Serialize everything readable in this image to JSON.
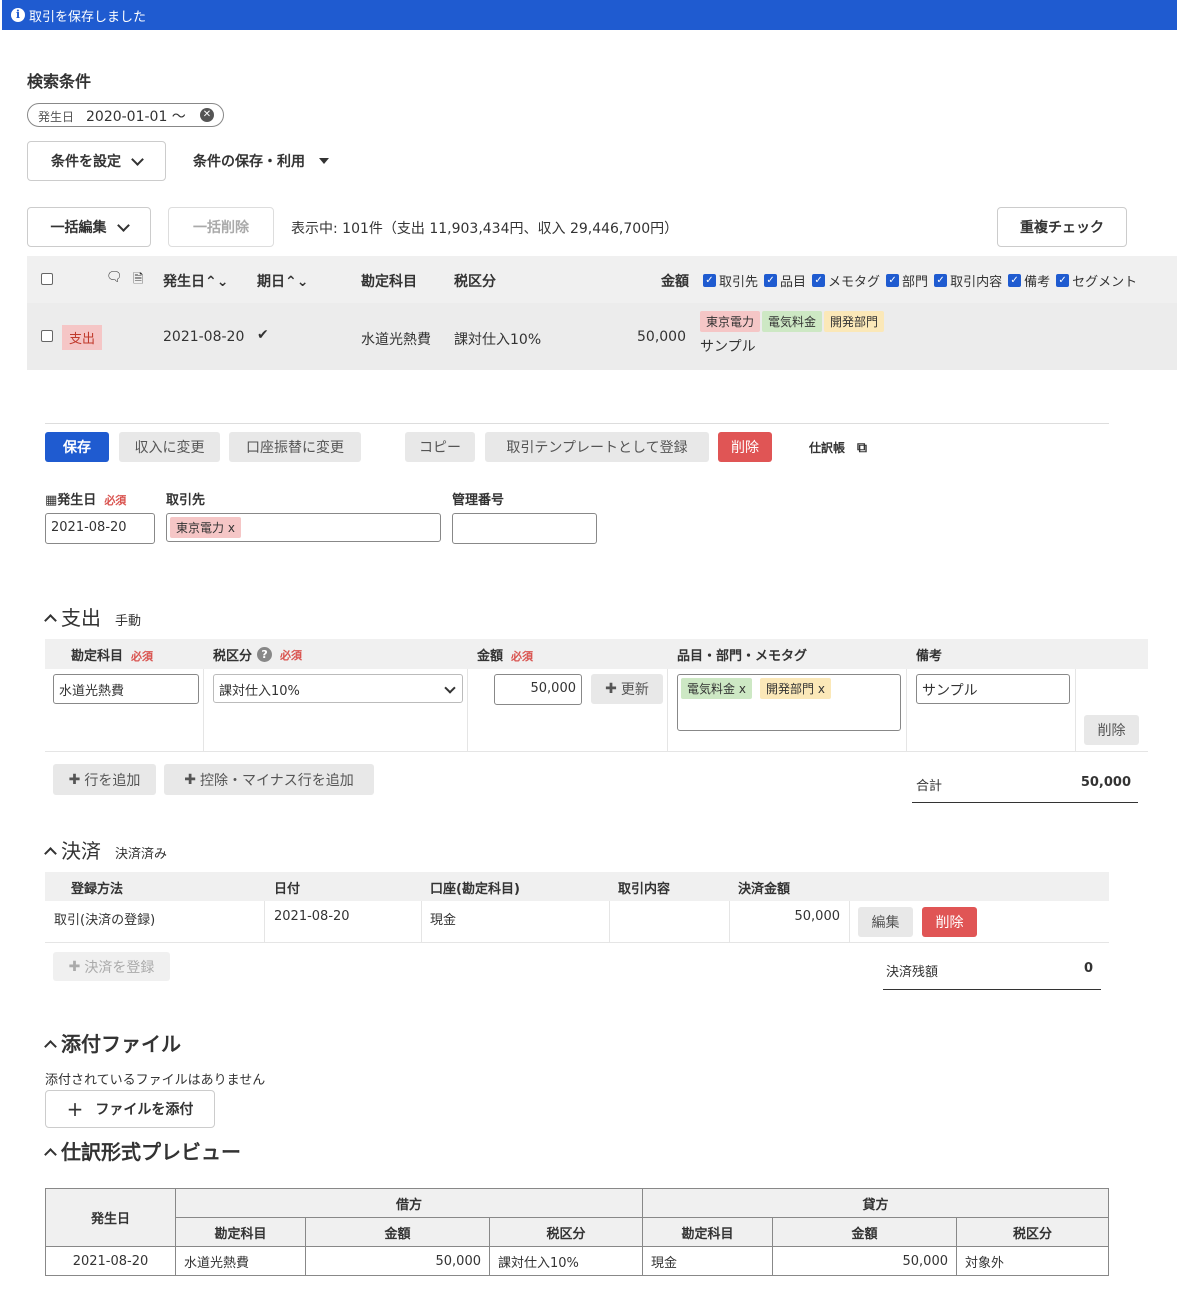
{
  "banner": {
    "text": "取引を保存しました"
  },
  "search": {
    "title": "検索条件",
    "chip_label": "発生日",
    "chip_value": "2020-01-01 〜",
    "set_conditions": "条件を設定",
    "save_use": "条件の保存・利用"
  },
  "toolbar": {
    "bulk_edit": "一括編集",
    "bulk_delete": "一括削除",
    "summary": "表示中: 101件（支出 11,903,434円、収入 29,446,700円）",
    "dup_check": "重複チェック"
  },
  "list": {
    "headers": {
      "date": "発生日",
      "due": "期日",
      "account": "勘定科目",
      "tax": "税区分",
      "amount": "金額"
    },
    "toggles": [
      "取引先",
      "品目",
      "メモタグ",
      "部門",
      "取引内容",
      "備考",
      "セグメント"
    ],
    "row": {
      "type": "支出",
      "date": "2021-08-20",
      "account": "水道光熱費",
      "tax": "課対仕入10%",
      "amount": "50,000",
      "tags": [
        "東京電力",
        "電気料金",
        "開発部門"
      ],
      "memo": "サンプル"
    }
  },
  "actions": {
    "save": "保存",
    "to_income": "収入に変更",
    "to_transfer": "口座振替に変更",
    "copy": "コピー",
    "template": "取引テンプレートとして登録",
    "delete": "削除",
    "journal": "仕訳帳"
  },
  "form": {
    "date_label": "発生日",
    "required": "必須",
    "date_value": "2021-08-20",
    "partner_label": "取引先",
    "partner_value": "東京電力",
    "mgmt_label": "管理番号"
  },
  "expense": {
    "title": "支出",
    "mode": "手動",
    "headers": {
      "account": "勘定科目",
      "tax": "税区分",
      "amount": "金額",
      "tags": "品目・部門・メモタグ",
      "memo": "備考"
    },
    "row": {
      "account": "水道光熱費",
      "tax": "課対仕入10%",
      "amount": "50,000",
      "update": "更新",
      "tags": [
        "電気料金",
        "開発部門"
      ],
      "memo": "サンプル",
      "delete": "削除"
    },
    "add_row": "行を追加",
    "add_minus": "控除・マイナス行を追加",
    "total_label": "合計",
    "total_value": "50,000"
  },
  "settlement": {
    "title": "決済",
    "status": "決済済み",
    "headers": [
      "登録方法",
      "日付",
      "口座(勘定科目)",
      "取引内容",
      "決済金額"
    ],
    "row": {
      "method": "取引(決済の登録)",
      "date": "2021-08-20",
      "account": "現金",
      "content": "",
      "amount": "50,000",
      "edit": "編集",
      "delete": "削除"
    },
    "register": "決済を登録",
    "balance_label": "決済残額",
    "balance_value": "0"
  },
  "attach": {
    "title": "添付ファイル",
    "empty": "添付されているファイルはありません",
    "button": "ファイルを添付"
  },
  "preview": {
    "title": "仕訳形式プレビュー",
    "h_date": "発生日",
    "h_debit": "借方",
    "h_credit": "貸方",
    "h_account": "勘定科目",
    "h_amount": "金額",
    "h_tax": "税区分",
    "row": {
      "date": "2021-08-20",
      "d_account": "水道光熱費",
      "d_amount": "50,000",
      "d_tax": "課対仕入10%",
      "c_account": "現金",
      "c_amount": "50,000",
      "c_tax": "対象外"
    }
  },
  "colors": {
    "primary": "#1f5bd0",
    "danger": "#e05555"
  }
}
